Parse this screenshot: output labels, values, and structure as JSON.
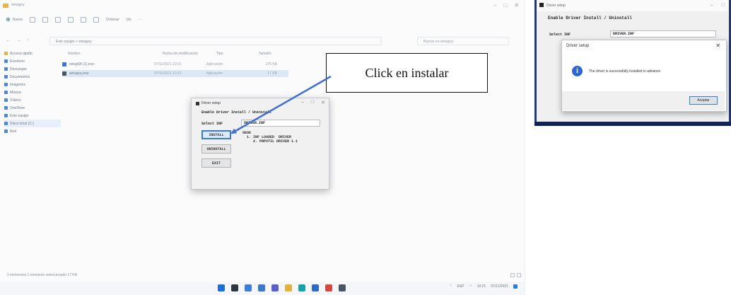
{
  "explorer": {
    "window_title": "setupjoy",
    "new_label": "Nuevo",
    "sort_label": "Ordenar",
    "view_label": "Ver",
    "more_label": "···",
    "address_path": "Este equipo  >  setupjoy",
    "search_placeholder": "Buscar en setupjoy",
    "nav_items": [
      {
        "label": "Acceso rápido"
      },
      {
        "label": "Escritorio"
      },
      {
        "label": "Descargas"
      },
      {
        "label": "Documentos"
      },
      {
        "label": "Imágenes"
      },
      {
        "label": "Música"
      },
      {
        "label": "Vídeos"
      },
      {
        "label": "OneDrive"
      },
      {
        "label": "Este equipo"
      },
      {
        "label": "Disco local (C:)"
      },
      {
        "label": "Red"
      }
    ],
    "columns": {
      "name": "Nombre",
      "modified": "Fecha de modificación",
      "type": "Tipo",
      "size": "Tamaño"
    },
    "files": [
      {
        "name": "setup64 (1).exe",
        "modified": "07/11/2021 10:21",
        "type": "Aplicación",
        "size": "176 KB"
      },
      {
        "name": "setupjoy.exe",
        "modified": "07/11/2021 10:21",
        "type": "Aplicación",
        "size": "17 KB"
      }
    ],
    "status_text": "2 elementos   1 elemento seleccionado  17 KB"
  },
  "taskbar": {
    "icons": [
      {
        "name": "start",
        "color": "#1f6fd1"
      },
      {
        "name": "search",
        "color": "#2f3640"
      },
      {
        "name": "task-view",
        "color": "#3b7dd8"
      },
      {
        "name": "widgets",
        "color": "#3a78d0"
      },
      {
        "name": "chat",
        "color": "#5b5fc7"
      },
      {
        "name": "file-explorer",
        "color": "#e4b23b"
      },
      {
        "name": "edge",
        "color": "#1aa1a8"
      },
      {
        "name": "store",
        "color": "#2c6bc8"
      },
      {
        "name": "chrome",
        "color": "#d54a3b"
      },
      {
        "name": "installer",
        "color": "#4a5564"
      }
    ],
    "tray_lang": "ESP",
    "tray_time": "10:21",
    "tray_date": "07/11/2021"
  },
  "installer": {
    "window_title": "Driver setup",
    "heading": "Enable Driver Install / Uninstall",
    "select_label": "Select INF",
    "file_name": "DRIVER.INF",
    "install_label": "INSTALL",
    "uninstall_label": "UNINSTALL",
    "exit_label": "EXIT",
    "info_lines": "OKOK\n  1. INF LOADED  DRIVER\n     2. PNPUTIL DRIVER 1.1"
  },
  "callout": {
    "text": "Click en instalar"
  },
  "right_shot": {
    "window_title": "Driver setup",
    "heading": "Enable Driver Install / Uninstall",
    "select_label": "Select INF",
    "file_name": "DRIVER.INF",
    "message_box": {
      "title": "Driver setup",
      "icon": "info-icon",
      "message": "The driver is successfully installed in advance",
      "ok_label": "Aceptar"
    }
  },
  "colors": {
    "accent": "#1a73d1",
    "desktop_blue": "#1f3a78",
    "arrow": "#3f6fd6",
    "info_icon": "#2e66d6"
  }
}
